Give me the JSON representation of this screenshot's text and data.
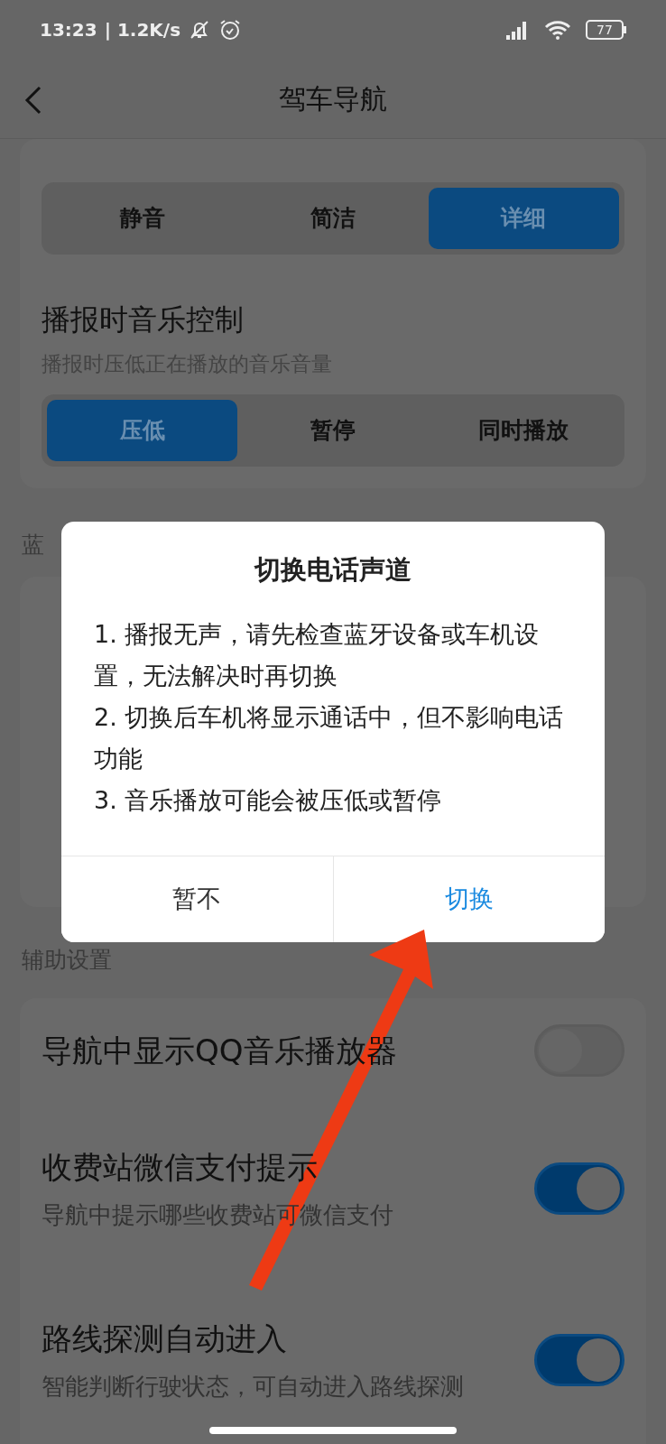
{
  "status_bar": {
    "time": "13:23",
    "speed": "| 1.2K/s",
    "battery": "77"
  },
  "header": {
    "title": "驾车导航"
  },
  "voice_modes": [
    {
      "label": "静音",
      "selected": false
    },
    {
      "label": "简洁",
      "selected": false
    },
    {
      "label": "详细",
      "selected": true
    }
  ],
  "music_control": {
    "title": "播报时音乐控制",
    "subtitle": "播报时压低正在播放的音乐音量",
    "options": [
      {
        "label": "压低",
        "selected": true
      },
      {
        "label": "暂停",
        "selected": false
      },
      {
        "label": "同时播放",
        "selected": false
      }
    ]
  },
  "bluetooth_section": {
    "title": "蓝"
  },
  "dialog": {
    "title": "切换电话声道",
    "lines": [
      "1. 播报无声，请先检查蓝牙设备或车机设置，无法解决时再切换",
      "2. 切换后车机将显示通话中，但不影响电话功能",
      "3. 音乐播放可能会被压低或暂停"
    ],
    "buttons": [
      {
        "label": "暂不",
        "kind": "cancel"
      },
      {
        "label": "切换",
        "kind": "confirm"
      }
    ]
  },
  "assist_section": {
    "title": "辅助设置",
    "items": [
      {
        "title": "导航中显示QQ音乐播放器",
        "on": false
      },
      {
        "title": "收费站微信支付提示",
        "subtitle": "导航中提示哪些收费站可微信支付",
        "on": true
      },
      {
        "title": "路线探测自动进入",
        "subtitle": "智能判断行驶状态，可自动进入路线探测",
        "on": true
      }
    ]
  }
}
